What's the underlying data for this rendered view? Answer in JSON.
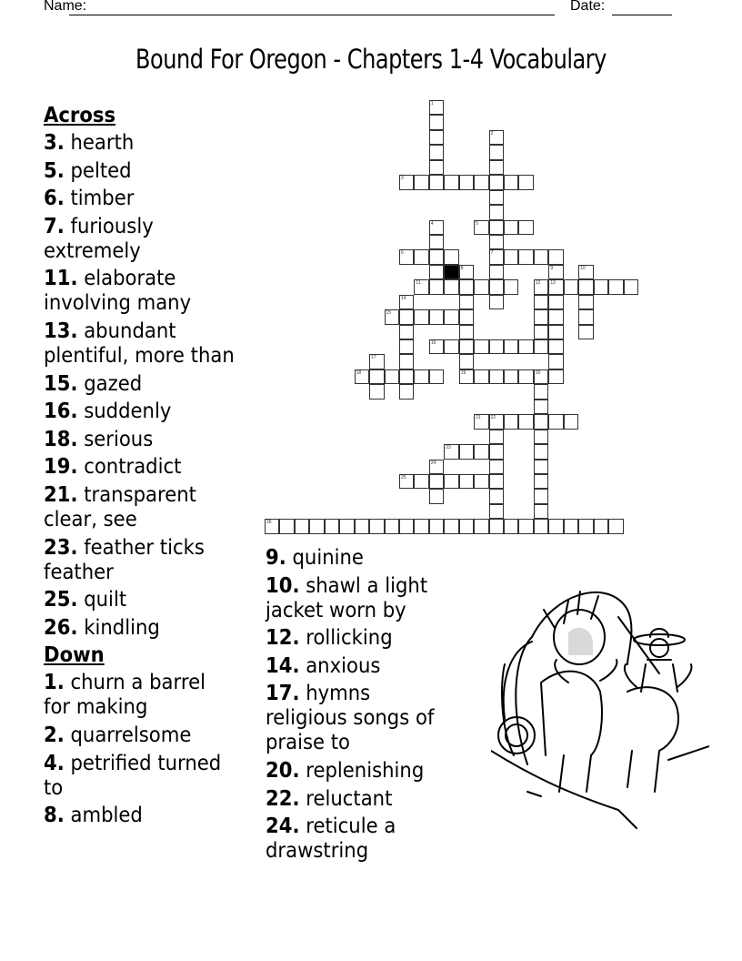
{
  "header": {
    "name_label": "Name:",
    "date_label": "Date:"
  },
  "title": "Bound For Oregon - Chapters 1-4 Vocabulary",
  "across": {
    "heading": "Across",
    "clues": [
      {
        "num": "3.",
        "text": "hearth"
      },
      {
        "num": "5.",
        "text": "pelted"
      },
      {
        "num": "6.",
        "text": "timber"
      },
      {
        "num": "7.",
        "text": "furiously extremely"
      },
      {
        "num": "11.",
        "text": "elaborate involving many"
      },
      {
        "num": "13.",
        "text": "abundant plentiful, more than"
      },
      {
        "num": "15.",
        "text": "gazed"
      },
      {
        "num": "16.",
        "text": "suddenly"
      },
      {
        "num": "18.",
        "text": "serious"
      },
      {
        "num": "19.",
        "text": "contradict"
      },
      {
        "num": "21.",
        "text": "transparent clear, see"
      },
      {
        "num": "23.",
        "text": "feather ticks feather"
      },
      {
        "num": "25.",
        "text": "quilt"
      },
      {
        "num": "26.",
        "text": "kindling"
      }
    ]
  },
  "down": {
    "heading": "Down",
    "clues": [
      {
        "num": "1.",
        "text": "churn a barrel for making"
      },
      {
        "num": "2.",
        "text": "quarrelsome"
      },
      {
        "num": "4.",
        "text": "petrified turned to"
      },
      {
        "num": "8.",
        "text": "ambled"
      },
      {
        "num": "9.",
        "text": "quinine"
      },
      {
        "num": "10.",
        "text": "shawl a light jacket worn by"
      },
      {
        "num": "12.",
        "text": "rollicking"
      },
      {
        "num": "14.",
        "text": "anxious"
      },
      {
        "num": "17.",
        "text": "hymns religious songs of praise to"
      },
      {
        "num": "20.",
        "text": "replenishing"
      },
      {
        "num": "22.",
        "text": "reluctant"
      },
      {
        "num": "24.",
        "text": "reticule a drawstring"
      }
    ]
  },
  "grid": {
    "entries": [
      {
        "num": 1,
        "dir": "down",
        "row": 0,
        "col": 11,
        "len": 6
      },
      {
        "num": 2,
        "dir": "down",
        "row": 2,
        "col": 15,
        "len": 12
      },
      {
        "num": 3,
        "dir": "across",
        "row": 5,
        "col": 9,
        "len": 9
      },
      {
        "num": 4,
        "dir": "down",
        "row": 8,
        "col": 11,
        "len": 5
      },
      {
        "num": 5,
        "dir": "across",
        "row": 8,
        "col": 14,
        "len": 4
      },
      {
        "num": 6,
        "dir": "across",
        "row": 10,
        "col": 9,
        "len": 4
      },
      {
        "num": 7,
        "dir": "across",
        "row": 10,
        "col": 15,
        "len": 5
      },
      {
        "num": 8,
        "dir": "down",
        "row": 11,
        "col": 13,
        "len": 8
      },
      {
        "num": 9,
        "dir": "down",
        "row": 11,
        "col": 19,
        "len": 8
      },
      {
        "num": 10,
        "dir": "down",
        "row": 11,
        "col": 21,
        "len": 5
      },
      {
        "num": 11,
        "dir": "across",
        "row": 12,
        "col": 10,
        "len": 7
      },
      {
        "num": 12,
        "dir": "down",
        "row": 12,
        "col": 18,
        "len": 5
      },
      {
        "num": 13,
        "dir": "across",
        "row": 12,
        "col": 19,
        "len": 6
      },
      {
        "num": 14,
        "dir": "down",
        "row": 13,
        "col": 9,
        "len": 7
      },
      {
        "num": 15,
        "dir": "across",
        "row": 14,
        "col": 8,
        "len": 6
      },
      {
        "num": 16,
        "dir": "across",
        "row": 16,
        "col": 11,
        "len": 8
      },
      {
        "num": 17,
        "dir": "down",
        "row": 17,
        "col": 7,
        "len": 3
      },
      {
        "num": 18,
        "dir": "across",
        "row": 18,
        "col": 6,
        "len": 6
      },
      {
        "num": 19,
        "dir": "across",
        "row": 18,
        "col": 13,
        "len": 7
      },
      {
        "num": 20,
        "dir": "down",
        "row": 18,
        "col": 18,
        "len": 11
      },
      {
        "num": 21,
        "dir": "across",
        "row": 21,
        "col": 14,
        "len": 7
      },
      {
        "num": 22,
        "dir": "down",
        "row": 21,
        "col": 15,
        "len": 8
      },
      {
        "num": 23,
        "dir": "across",
        "row": 23,
        "col": 12,
        "len": 4
      },
      {
        "num": 24,
        "dir": "down",
        "row": 24,
        "col": 11,
        "len": 3
      },
      {
        "num": 25,
        "dir": "across",
        "row": 25,
        "col": 9,
        "len": 7
      },
      {
        "num": 26,
        "dir": "across",
        "row": 28,
        "col": 0,
        "len": 24
      }
    ],
    "black_cells": [
      [
        11,
        12
      ]
    ]
  },
  "illustration": {
    "icon": "covered-wagon-oxen-illustration"
  }
}
